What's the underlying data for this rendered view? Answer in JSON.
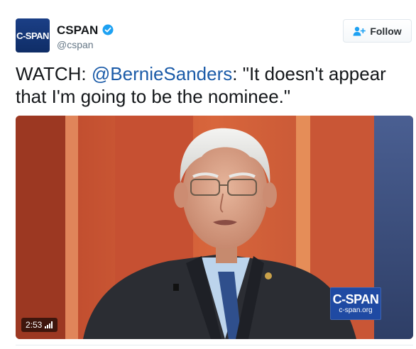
{
  "account": {
    "avatar_text": "C-SPAN",
    "name": "CSPAN",
    "handle": "@cspan",
    "verified": true,
    "avatar_color": "#12306b"
  },
  "follow_button": {
    "label": "Follow",
    "icon": "add-user-icon"
  },
  "tweet": {
    "prefix": "WATCH: ",
    "mention": "@BernieSanders",
    "quote": ": \"It doesn't appear that I'm going to be the nominee.\"",
    "mention_color": "#1b5ba8"
  },
  "media": {
    "duration": "2:53",
    "duration_icon": "volume-bars-icon",
    "watermark_line1": "C-SPAN",
    "watermark_line2": "c-span.org",
    "watermark_color": "#1f4aa3"
  }
}
